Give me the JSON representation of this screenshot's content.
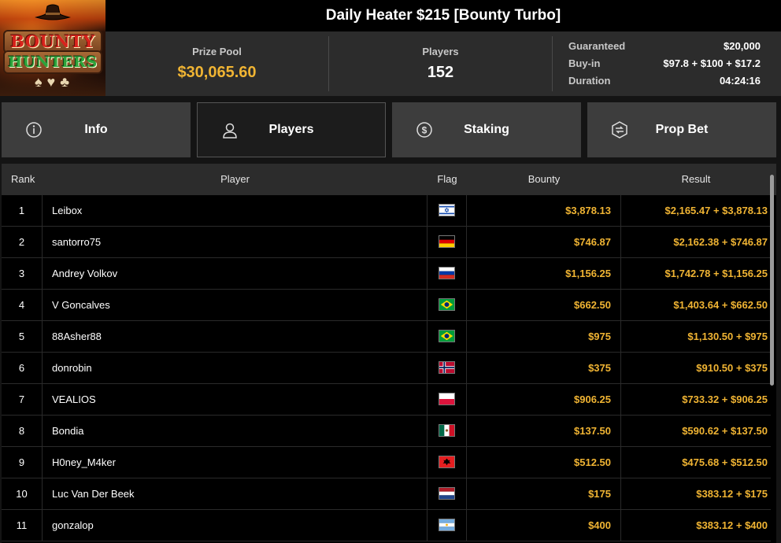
{
  "tournament": {
    "title": "Daily Heater $215 [Bounty Turbo]",
    "logo_text_top": "BOUNTY",
    "logo_text_bottom": "HUNTERS"
  },
  "stats": {
    "prize_pool_label": "Prize Pool",
    "prize_pool_value": "$30,065.60",
    "players_label": "Players",
    "players_value": "152",
    "guaranteed_label": "Guaranteed",
    "guaranteed_value": "$20,000",
    "buyin_label": "Buy-in",
    "buyin_value": "$97.8 + $100 + $17.2",
    "duration_label": "Duration",
    "duration_value": "04:24:16"
  },
  "tabs": [
    {
      "label": "Info",
      "icon": "info-icon"
    },
    {
      "label": "Players",
      "icon": "user-icon"
    },
    {
      "label": "Staking",
      "icon": "staking-icon"
    },
    {
      "label": "Prop Bet",
      "icon": "prop-bet-icon"
    }
  ],
  "active_tab": "Players",
  "table": {
    "headers": {
      "rank": "Rank",
      "player": "Player",
      "flag": "Flag",
      "bounty": "Bounty",
      "result": "Result"
    },
    "rows": [
      {
        "rank": "1",
        "player": "Leibox",
        "flag": "israel",
        "bounty": "$3,878.13",
        "result": "$2,165.47 + $3,878.13"
      },
      {
        "rank": "2",
        "player": "santorro75",
        "flag": "germany",
        "bounty": "$746.87",
        "result": "$2,162.38 + $746.87"
      },
      {
        "rank": "3",
        "player": "Andrey Volkov",
        "flag": "russia",
        "bounty": "$1,156.25",
        "result": "$1,742.78 + $1,156.25"
      },
      {
        "rank": "4",
        "player": "V Goncalves",
        "flag": "brazil",
        "bounty": "$662.50",
        "result": "$1,403.64 + $662.50"
      },
      {
        "rank": "5",
        "player": "88Asher88",
        "flag": "brazil",
        "bounty": "$975",
        "result": "$1,130.50 + $975"
      },
      {
        "rank": "6",
        "player": "donrobin",
        "flag": "norway",
        "bounty": "$375",
        "result": "$910.50 + $375"
      },
      {
        "rank": "7",
        "player": "VEALIOS",
        "flag": "poland",
        "bounty": "$906.25",
        "result": "$733.32 + $906.25"
      },
      {
        "rank": "8",
        "player": "Bondia",
        "flag": "mexico",
        "bounty": "$137.50",
        "result": "$590.62 + $137.50"
      },
      {
        "rank": "9",
        "player": "H0ney_M4ker",
        "flag": "albania",
        "bounty": "$512.50",
        "result": "$475.68 + $512.50"
      },
      {
        "rank": "10",
        "player": "Luc Van Der Beek",
        "flag": "netherlands",
        "bounty": "$175",
        "result": "$383.12 + $175"
      },
      {
        "rank": "11",
        "player": "gonzalop",
        "flag": "argentina",
        "bounty": "$400",
        "result": "$383.12 + $400"
      }
    ]
  },
  "colors": {
    "accent_gold": "#f0b433",
    "tab_bg": "#3d3d3d",
    "tab_active_bg": "#1c1c1c",
    "header_bar": "#000000",
    "stats_bg": "#2c2c2c"
  }
}
